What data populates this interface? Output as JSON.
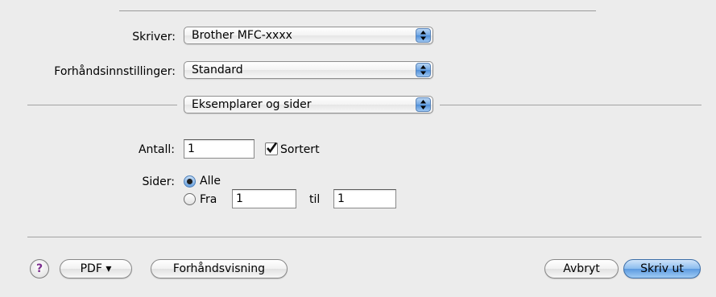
{
  "printer": {
    "label": "Skriver:",
    "value": "Brother MFC-xxxx"
  },
  "presets": {
    "label": "Forhåndsinnstillinger:",
    "value": "Standard"
  },
  "section": {
    "value": "Eksemplarer og sider"
  },
  "copies": {
    "label": "Antall:",
    "value": "1",
    "collated_label": "Sortert",
    "collated": true
  },
  "pages": {
    "label": "Sider:",
    "all_label": "Alle",
    "from_label": "Fra",
    "from_value": "1",
    "to_label": "til",
    "to_value": "1",
    "selected": "all"
  },
  "footer": {
    "help": "?",
    "pdf_label": "PDF ▾",
    "preview_label": "Forhåndsvisning",
    "cancel_label": "Avbryt",
    "print_label": "Skriv ut"
  }
}
